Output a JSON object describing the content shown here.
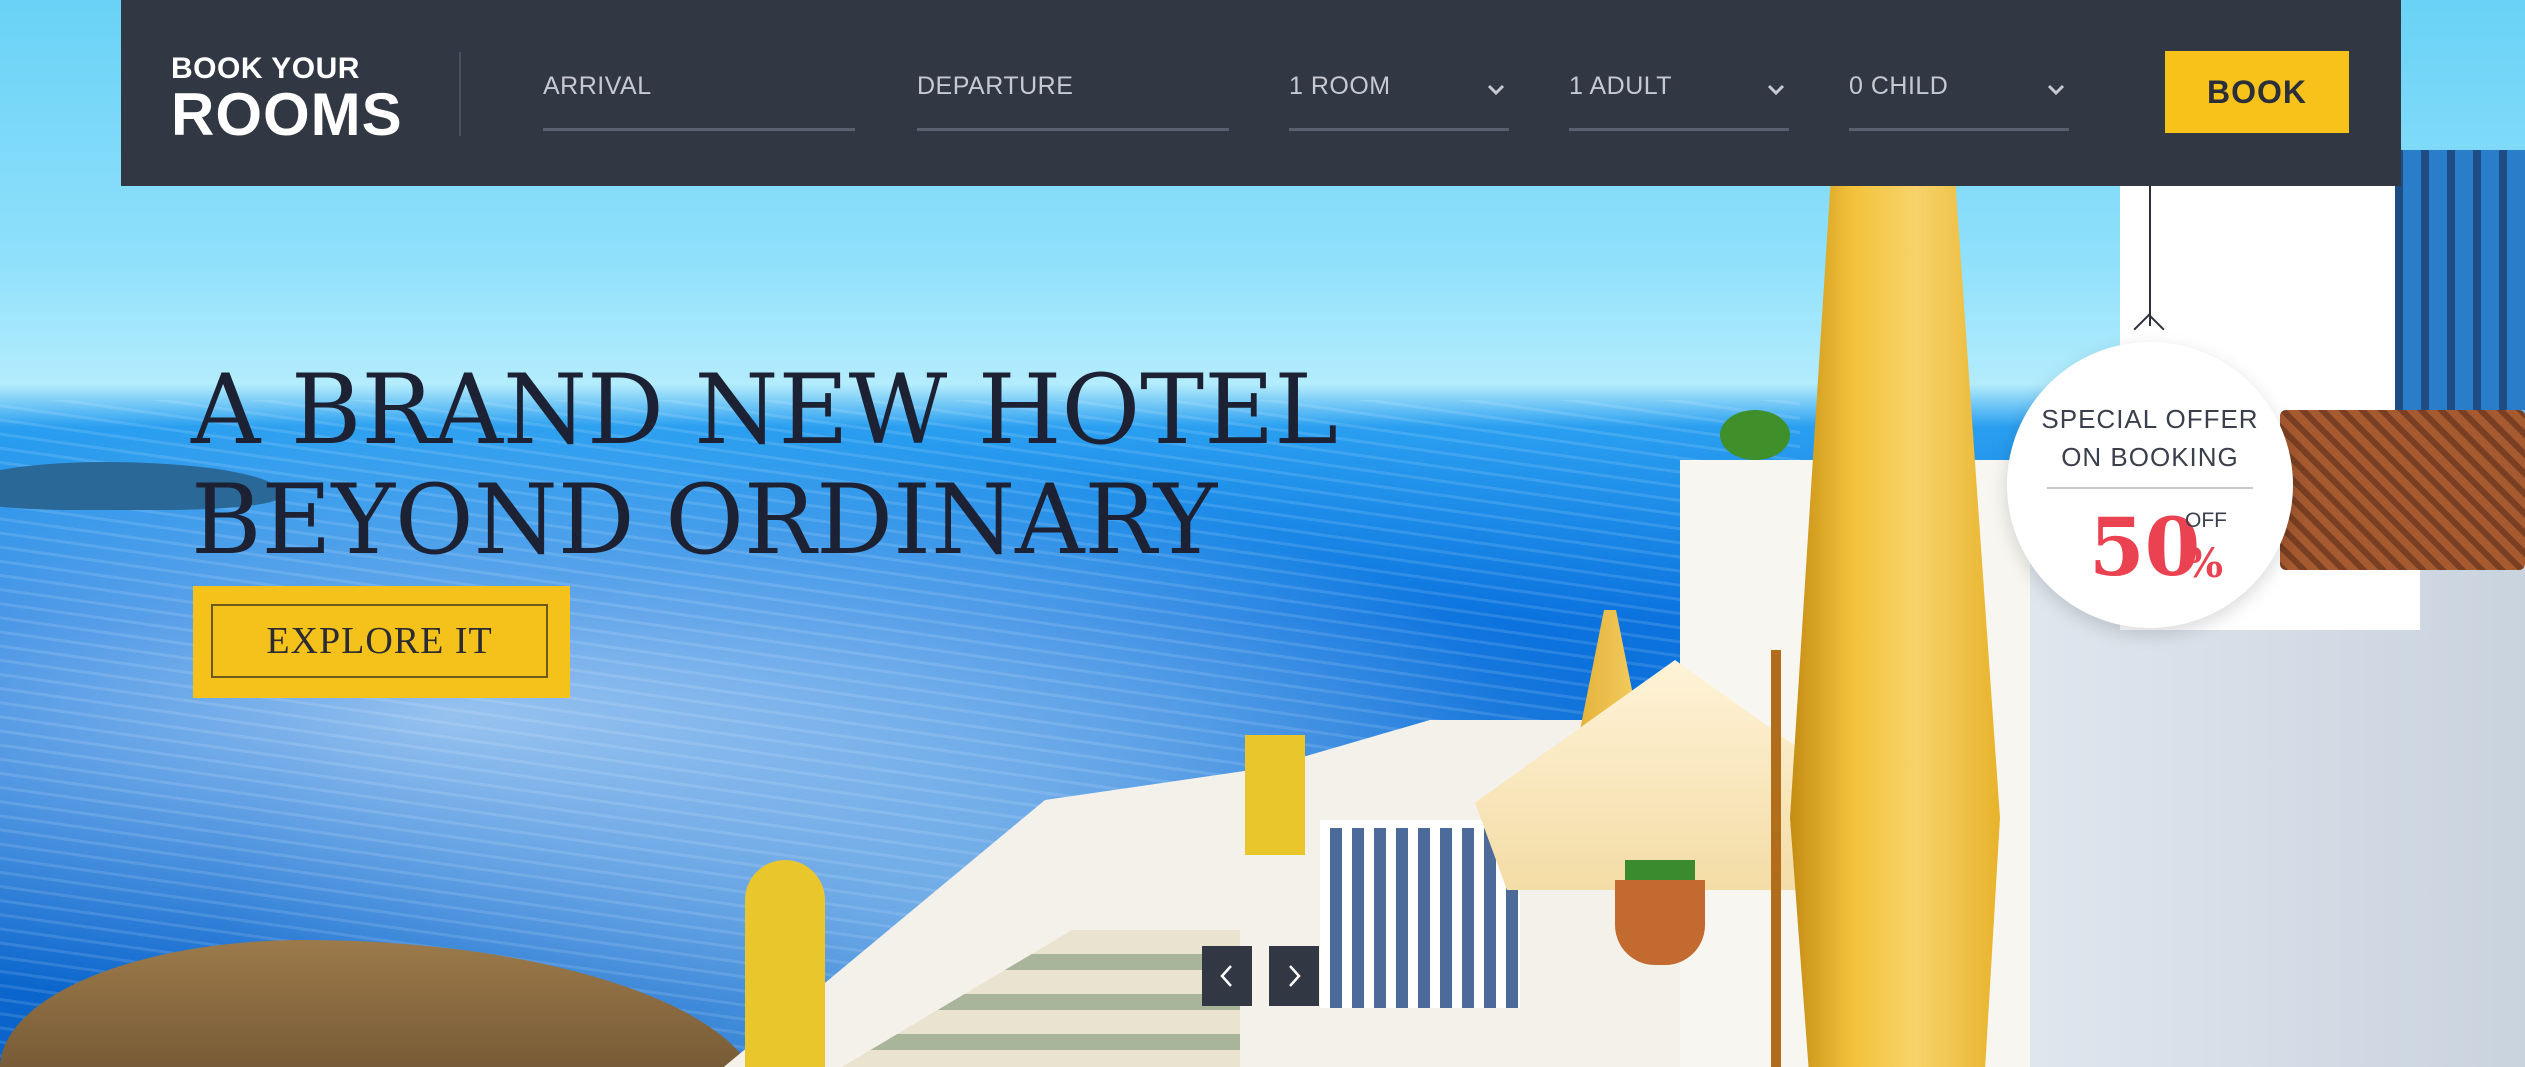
{
  "brand": {
    "line1": "BOOK YOUR",
    "line2": "ROOMS"
  },
  "booking": {
    "arrival_label": "ARRIVAL",
    "departure_label": "DEPARTURE",
    "rooms_value": "1 ROOM",
    "adults_value": "1 ADULT",
    "children_value": "0 CHILD",
    "book_label": "BOOK"
  },
  "hero": {
    "headline_line1": "A BRAND NEW HOTEL",
    "headline_line2": "BEYOND ORDINARY",
    "cta_label": "EXPLORE IT"
  },
  "offer": {
    "line1": "SPECIAL OFFER",
    "line2": "ON BOOKING",
    "value": "50",
    "percent_sign": "%",
    "suffix": "OFF"
  },
  "slider": {
    "prev_icon": "chevron-left-icon",
    "next_icon": "chevron-right-icon"
  },
  "colors": {
    "bar_background": "#323744",
    "accent_yellow": "#f7c21a",
    "offer_red": "#ea4250",
    "headline_dark": "#1c2233"
  }
}
